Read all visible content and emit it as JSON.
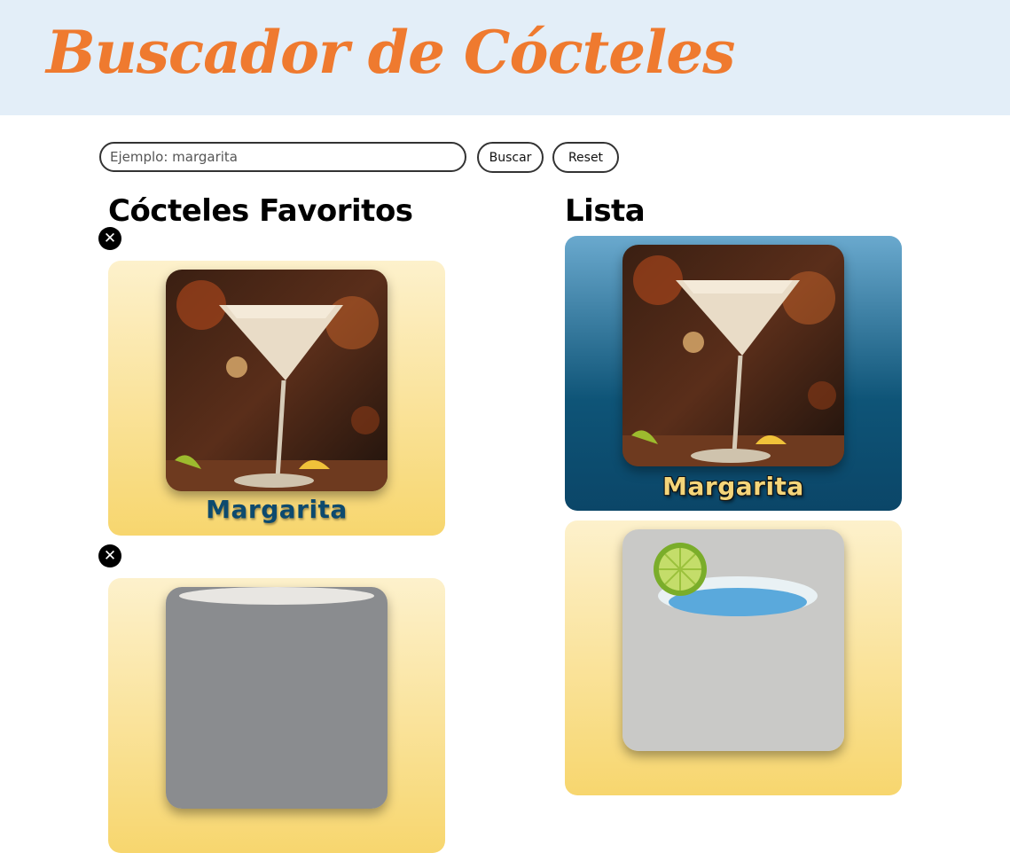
{
  "header": {
    "title": "Buscador de Cócteles"
  },
  "search": {
    "placeholder": "Ejemplo: margarita",
    "value": "",
    "search_label": "Buscar",
    "reset_label": "Reset"
  },
  "favorites": {
    "title": "Cócteles Favoritos",
    "remove_symbol": "✕",
    "items": [
      {
        "name": "Margarita",
        "image": "margarita-photo"
      },
      {
        "name": "",
        "image": "cocktail-photo-partial"
      }
    ]
  },
  "list": {
    "title": "Lista",
    "items": [
      {
        "name": "Margarita",
        "image": "margarita-photo"
      },
      {
        "name": "",
        "image": "blue-margarita-photo"
      }
    ]
  },
  "colors": {
    "header_bg": "#e3eef8",
    "title": "#ef7a2f",
    "card_yellow_top": "#fdf1cc",
    "card_yellow_bottom": "#f7d66e",
    "card_blue_top": "#6aa9ce",
    "card_blue_bottom": "#0b4668"
  }
}
